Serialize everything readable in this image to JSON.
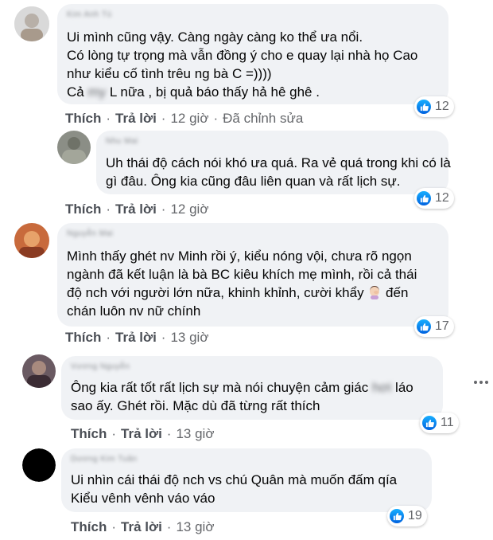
{
  "comments": [
    {
      "author": "Kim Anh Tú",
      "lines": [
        "Ui mình cũng vậy. Càng ngày càng ko thể ưa nổi.",
        "Có lòng tự trọng mà vẫn đồng ý cho e quay lại nhà họ Cao",
        "như kiểu cố tình trêu ng bà C =))))"
      ],
      "last_line_pre": "Cả ",
      "last_line_blur": "my",
      "last_line_post": " L nữa , bị quả báo thấy hả hê ghê .",
      "like_label": "Thích",
      "reply_label": "Trả lời",
      "time": "12 giờ",
      "edited": "Đã chỉnh sửa",
      "reactions": "12",
      "avatar_color": "#e7e7e7"
    },
    {
      "author": "Nhu Mai",
      "lines": [
        "Uh thái độ cách nói khó ưa quá. Ra vẻ quá trong khi có là",
        "gì đâu. Ông kia cũng đâu liên quan và rất lịch sự."
      ],
      "like_label": "Thích",
      "reply_label": "Trả lời",
      "time": "12 giờ",
      "reactions": "12",
      "avatar_color": "#8c8f86"
    },
    {
      "author": "Nguyễn Mai",
      "lines": [
        "Mình thấy ghét nv Minh rồi ý, kiểu nóng vội, chưa rõ ngọn",
        "ngành đã kết luận là bà BC kiêu khích mẹ mình, rồi cả thái",
        "độ nch với người lớn nữa, khinh khỉnh, cười khẩy",
        "chán luôn nv nữ chính"
      ],
      "emoji_line_suffix": " đến",
      "like_label": "Thích",
      "reply_label": "Trả lời",
      "time": "13 giờ",
      "reactions": "17",
      "avatar_color": "#c0653a"
    },
    {
      "author": "Vương Nguyễn",
      "line1_pre": "Ông kia rất tốt rất lịch sự mà nói chuyện cảm giác ",
      "line1_blur": "hơi",
      "line1_post": " láo",
      "lines": [
        "sao ấy. Ghét rồi. Mặc dù đã từng rất thích"
      ],
      "like_label": "Thích",
      "reply_label": "Trả lời",
      "time": "13 giờ",
      "reactions": "11",
      "avatar_color": "#5b4a55"
    },
    {
      "author": "Dương Kim Tuân",
      "lines": [
        "Ui nhìn cái thái độ nch vs chú Quân mà muốn đấm qía",
        "Kiểu vênh vênh váo váo"
      ],
      "like_label": "Thích",
      "reply_label": "Trả lời",
      "time": "13 giờ",
      "reactions": "19",
      "avatar_color": "#000000"
    }
  ],
  "colors": {
    "like_blue": "#1877f2",
    "bubble": "#f0f2f5",
    "meta": "#65676b"
  }
}
